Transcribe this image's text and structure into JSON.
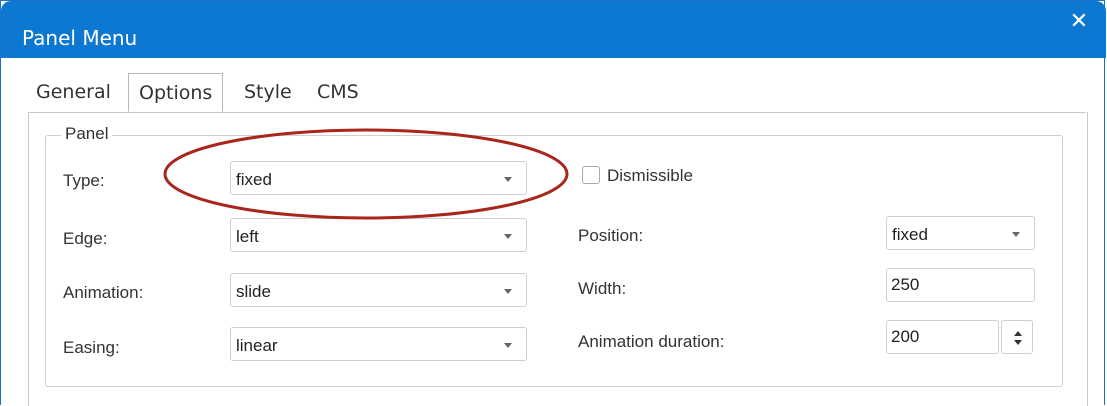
{
  "window": {
    "title": "Panel Menu"
  },
  "tabs": [
    {
      "label": "General"
    },
    {
      "label": "Options"
    },
    {
      "label": "Style"
    },
    {
      "label": "CMS"
    }
  ],
  "active_tab": "Options",
  "panel": {
    "legend": "Panel",
    "type": {
      "label": "Type:",
      "value": "fixed"
    },
    "edge": {
      "label": "Edge:",
      "value": "left"
    },
    "animation": {
      "label": "Animation:",
      "value": "slide"
    },
    "easing": {
      "label": "Easing:",
      "value": "linear"
    },
    "dismissible": {
      "label": "Dismissible",
      "checked": false
    },
    "position": {
      "label": "Position:",
      "value": "fixed"
    },
    "width": {
      "label": "Width:",
      "value": "250"
    },
    "animation_duration": {
      "label": "Animation duration:",
      "value": "200"
    }
  },
  "colors": {
    "titlebar": "#0d78d2",
    "highlight_ellipse": "#a8261c"
  }
}
